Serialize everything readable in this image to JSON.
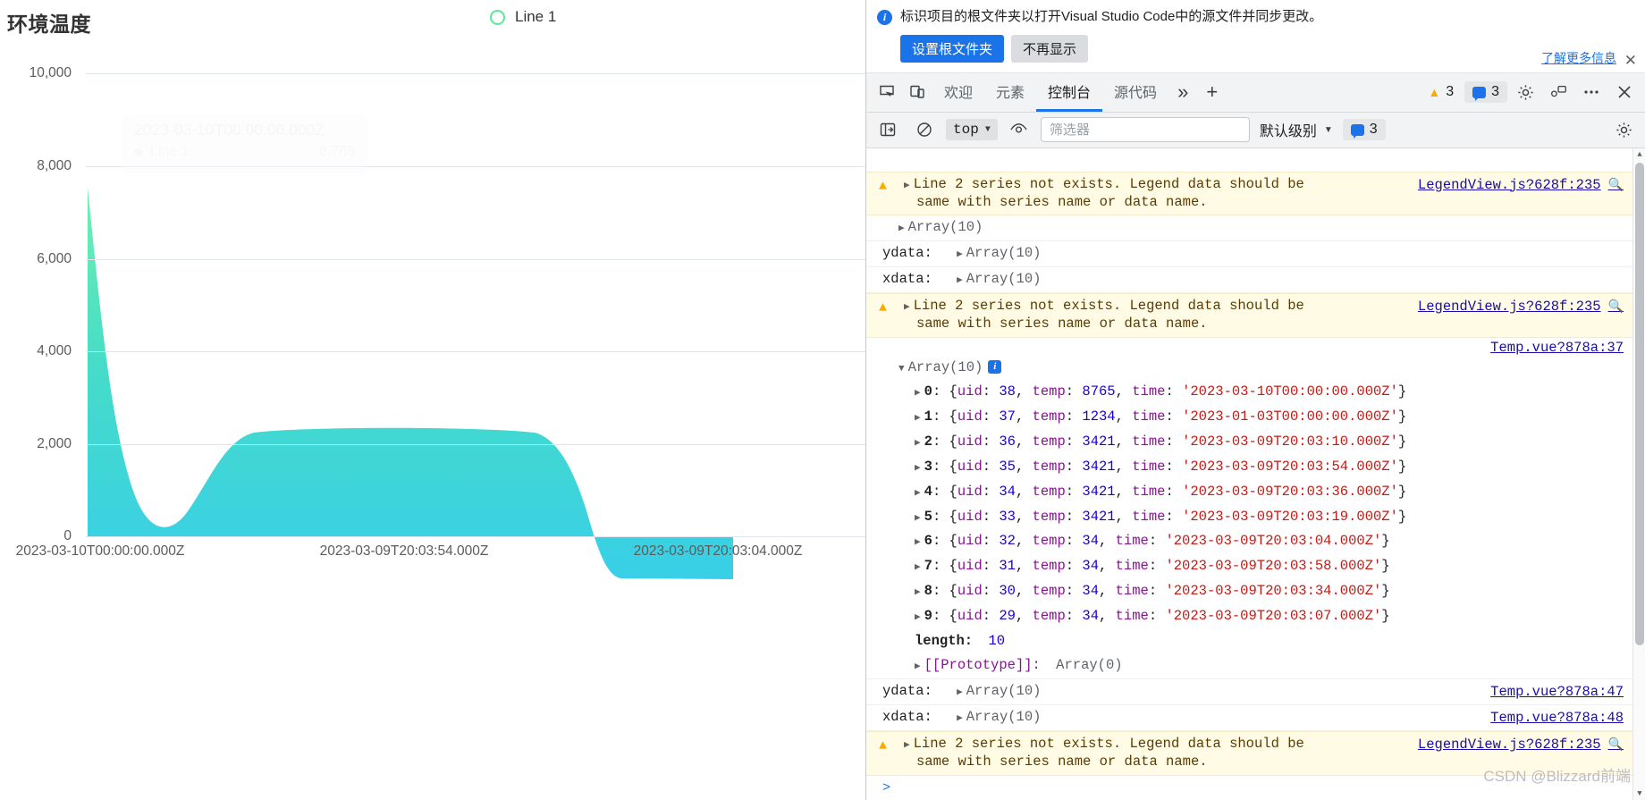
{
  "chart": {
    "title": "环境温度",
    "legend": [
      {
        "label": "Line 1",
        "color": "#5ee69a"
      }
    ],
    "tooltip": {
      "time": "2023-03-10T00:00:00.000Z",
      "series_label": "Line 1",
      "value": "8,765"
    }
  },
  "chart_data": {
    "type": "area",
    "title": "环境温度",
    "xlabel": "",
    "ylabel": "",
    "ylim": [
      0,
      10000
    ],
    "yticks": [
      "0",
      "2,000",
      "4,000",
      "6,000",
      "8,000",
      "10,000"
    ],
    "ytick_values": [
      0,
      2000,
      4000,
      6000,
      8000,
      10000
    ],
    "xticks": [
      "2023-03-10T00:00:00.000Z",
      "2023-03-09T20:03:54.000Z",
      "2023-03-09T20:03:04.000Z"
    ],
    "grid": true,
    "legend": [
      "Line 1"
    ],
    "legend_position": "top-center",
    "series": [
      {
        "name": "Line 1",
        "x": [
          "2023-03-10T00:00:00.000Z",
          "2023-01-03T00:00:00.000Z",
          "2023-03-09T20:03:10.000Z",
          "2023-03-09T20:03:54.000Z",
          "2023-03-09T20:03:36.000Z",
          "2023-03-09T20:03:19.000Z",
          "2023-03-09T20:03:04.000Z",
          "2023-03-09T20:03:58.000Z",
          "2023-03-09T20:03:34.000Z",
          "2023-03-09T20:03:07.000Z"
        ],
        "values": [
          8765,
          1234,
          3421,
          3421,
          3421,
          3421,
          34,
          34,
          34,
          34
        ]
      }
    ]
  },
  "devtools": {
    "banner": {
      "text": "标识项目的根文件夹以打开Visual Studio Code中的源文件并同步更改。",
      "primary_button": "设置根文件夹",
      "secondary_button": "不再显示",
      "learn_more": "了解更多信息",
      "close_icon": "✕"
    },
    "tabs": [
      {
        "label": "欢迎",
        "active": false
      },
      {
        "label": "元素",
        "active": false
      },
      {
        "label": "控制台",
        "active": true
      },
      {
        "label": "源代码",
        "active": false
      }
    ],
    "tab_more": "»",
    "tab_add": "+",
    "badges": {
      "warnings": "3",
      "messages": "3"
    },
    "filterbar": {
      "context": "top",
      "filter_placeholder": "筛选器",
      "filter_value": "",
      "level": "默认级别",
      "message_count": "3"
    },
    "console": {
      "warning_message_line1": "Line 2 series not exists. Legend data should be",
      "warning_message_line2": "same with series name or data name.",
      "warning_source": "LegendView.js?628f:235",
      "array_label": "Array(10)",
      "ydata_label": "ydata:",
      "xdata_label": "xdata:",
      "length_label": "length:",
      "length_value": "10",
      "prototype_label": "[[Prototype]]:",
      "prototype_value": "Array(0)",
      "temp_source_37": "Temp.vue?878a:37",
      "temp_source_47": "Temp.vue?878a:47",
      "temp_source_48": "Temp.vue?878a:48",
      "entries": [
        {
          "index": "0",
          "uid": "38",
          "temp": "8765",
          "time": "'2023-03-10T00:00:00.000Z'"
        },
        {
          "index": "1",
          "uid": "37",
          "temp": "1234",
          "time": "'2023-01-03T00:00:00.000Z'"
        },
        {
          "index": "2",
          "uid": "36",
          "temp": "3421",
          "time": "'2023-03-09T20:03:10.000Z'"
        },
        {
          "index": "3",
          "uid": "35",
          "temp": "3421",
          "time": "'2023-03-09T20:03:54.000Z'"
        },
        {
          "index": "4",
          "uid": "34",
          "temp": "3421",
          "time": "'2023-03-09T20:03:36.000Z'"
        },
        {
          "index": "5",
          "uid": "33",
          "temp": "3421",
          "time": "'2023-03-09T20:03:19.000Z'"
        },
        {
          "index": "6",
          "uid": "32",
          "temp": "34",
          "time": "'2023-03-09T20:03:04.000Z'"
        },
        {
          "index": "7",
          "uid": "31",
          "temp": "34",
          "time": "'2023-03-09T20:03:58.000Z'"
        },
        {
          "index": "8",
          "uid": "30",
          "temp": "34",
          "time": "'2023-03-09T20:03:34.000Z'"
        },
        {
          "index": "9",
          "uid": "29",
          "temp": "34",
          "time": "'2023-03-09T20:03:07.000Z'"
        }
      ],
      "prompt": ">"
    }
  },
  "watermark": "CSDN @Blizzard前端"
}
